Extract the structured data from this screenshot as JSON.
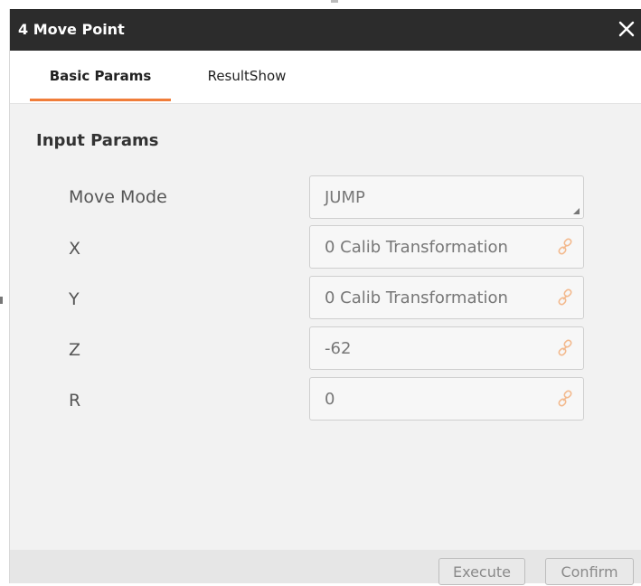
{
  "dialog": {
    "title": "4 Move Point",
    "close_icon": "close-icon"
  },
  "tabs": [
    {
      "label": "Basic Params",
      "active": true
    },
    {
      "label": "ResultShow",
      "active": false
    }
  ],
  "section": {
    "title": "Input Params"
  },
  "params": [
    {
      "label": "Move Mode",
      "value": "JUMP",
      "kind": "dropdown"
    },
    {
      "label": "X",
      "value": "0 Calib Transformation",
      "kind": "link",
      "icon": "link-icon"
    },
    {
      "label": "Y",
      "value": "0 Calib Transformation",
      "kind": "link",
      "icon": "link-icon"
    },
    {
      "label": "Z",
      "value": "-62",
      "kind": "link",
      "icon": "link-icon"
    },
    {
      "label": "R",
      "value": "0",
      "kind": "link",
      "icon": "link-icon"
    }
  ],
  "footer": {
    "execute_label": "Execute",
    "confirm_label": "Confirm"
  },
  "colors": {
    "titlebar": "#2c2c2c",
    "active_tab_underline": "#f07d3a",
    "content_bg": "#f2f2f2",
    "field_bg": "#f7f7f7",
    "footer_bg": "#e6e6e6"
  }
}
